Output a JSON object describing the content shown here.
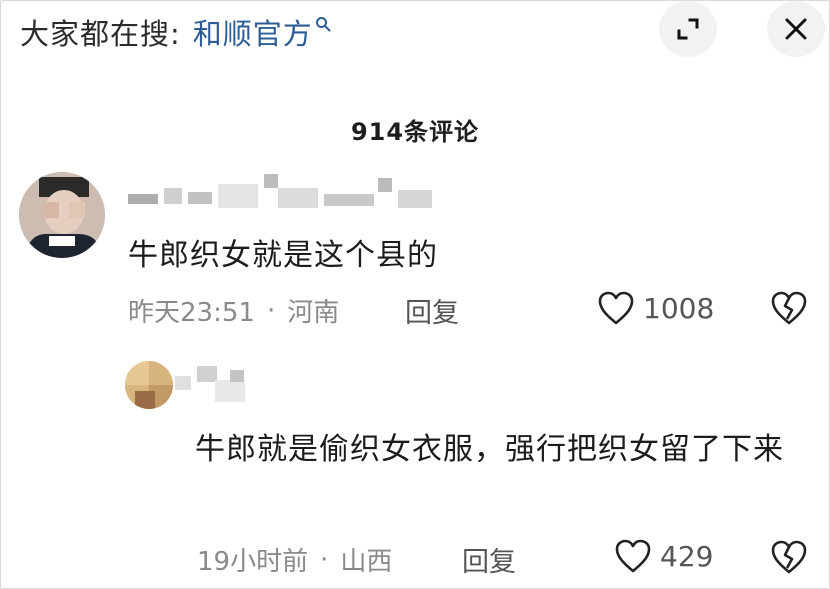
{
  "search": {
    "prefix": "大家都在搜:",
    "term": "和顺官方"
  },
  "header": {
    "comment_count": "914条评论"
  },
  "icons": {
    "search": "search-icon",
    "expand": "expand-icon",
    "close": "close-icon",
    "like": "heart-icon",
    "dislike": "broken-heart-icon"
  },
  "comments": [
    {
      "text": "牛郎织女就是这个县的",
      "time": "昨天23:51",
      "location": "河南",
      "reply_label": "回复",
      "likes": "1008"
    },
    {
      "text": "牛郎就是偷织女衣服，强行把织女留了下来",
      "time": "19小时前",
      "location": "山西",
      "reply_label": "回复",
      "likes": "429"
    }
  ],
  "colors": {
    "search_term": "#2e5d96",
    "meta_text": "#8a8a8a",
    "button_bg": "#f2f2f2"
  }
}
